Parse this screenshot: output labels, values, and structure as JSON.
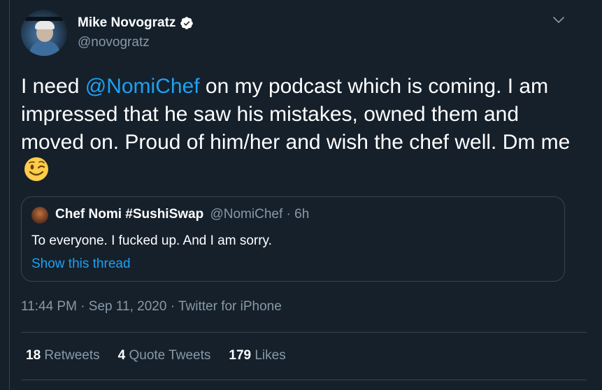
{
  "author": {
    "name": "Mike Novogratz",
    "handle": "@novogratz"
  },
  "tweet": {
    "text_1": "I need ",
    "mention": "@NomiChef",
    "text_2": " on my podcast which is coming.   I am impressed that he saw his mistakes, owned them and moved on.   Proud of him/her and wish the chef well.  Dm me ",
    "emoji": "winking-face"
  },
  "quoted_tweet": {
    "name": "Chef Nomi #SushiSwap",
    "handle_time": "@NomiChef · 6h",
    "text": "To everyone. I fucked up. And I am sorry.",
    "show_thread": "Show this thread"
  },
  "meta": {
    "timestamp": "11:44 PM · Sep 11, 2020 · Twitter for iPhone"
  },
  "stats": {
    "retweets_count": "18",
    "retweets_label": "Retweets",
    "quotes_count": "4",
    "quotes_label": "Quote Tweets",
    "likes_count": "179",
    "likes_label": "Likes"
  },
  "colors": {
    "background": "#15202b",
    "accent": "#1da1f2",
    "muted": "#8899a6",
    "border": "#38444d"
  }
}
